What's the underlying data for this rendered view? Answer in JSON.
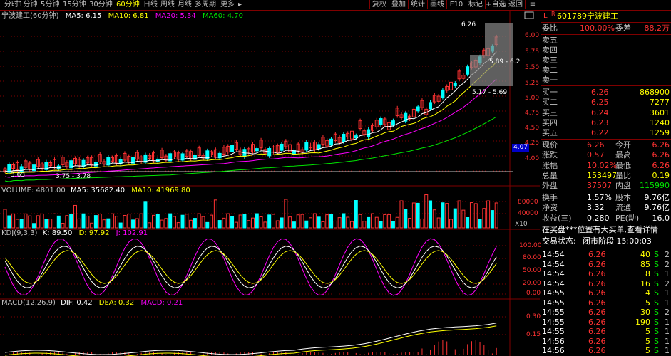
{
  "toolbar": {
    "timeframes": [
      "分时",
      "1分钟",
      "5分钟",
      "15分钟",
      "30分钟",
      "60分钟",
      "日线",
      "周线",
      "月线",
      "多周期",
      "更多"
    ],
    "active_timeframe": "60分钟",
    "buttons": [
      "复权",
      "叠加",
      "统计",
      "画线",
      "F10",
      "标记",
      "+自选",
      "返回"
    ]
  },
  "chart": {
    "title": "宁波建工(60分钟)",
    "ma": {
      "ma5": "MA5: 6.15",
      "ma10": "MA10: 6.81",
      "ma20": "MA20: 5.34",
      "ma60": "MA60: 4.70"
    },
    "price_axis": [
      "6.00",
      "5.75",
      "5.50",
      "5.25",
      "5.00",
      "4.75",
      "4.50",
      "4.25",
      "4.00"
    ],
    "current_price_tag": "4.07",
    "annotations": {
      "high": "6.26",
      "mid": "5.89 - 6.2",
      "low": "5.17 - 5.69",
      "min_low": "3.63",
      "pair_low": "3.75 - 3.78"
    },
    "volume": {
      "label": "VOLUME: 4801.00",
      "ma5": "MA5: 35682.40",
      "ma10": "MA10: 41969.80",
      "axis": [
        "80000",
        "40000"
      ],
      "unit": "X10"
    },
    "kdj": {
      "label": "KDJ(9,3,3)",
      "k": "K: 89.50",
      "d": "D: 97.92",
      "j": "J: 102.91",
      "axis": [
        "100.00",
        "80.00",
        "50.00",
        "20.00",
        "0.00"
      ]
    },
    "macd": {
      "label": "MACD(12,26,9)",
      "dif": "DIF: 0.42",
      "dea": "DEA: 0.32",
      "macd": "MACD: 0.21",
      "axis": [
        "0.30",
        "0.15"
      ]
    }
  },
  "stock": {
    "code": "601789",
    "name": "宁波建工"
  },
  "orderbook": {
    "weibi_label": "委比",
    "weibi": "100.00%",
    "weicha_label": "委差",
    "weicha": "88.2万",
    "sells": [
      {
        "label": "卖五",
        "price": "",
        "vol": ""
      },
      {
        "label": "卖四",
        "price": "",
        "vol": ""
      },
      {
        "label": "卖三",
        "price": "",
        "vol": ""
      },
      {
        "label": "卖二",
        "price": "",
        "vol": ""
      },
      {
        "label": "卖一",
        "price": "",
        "vol": ""
      }
    ],
    "buys": [
      {
        "label": "买一",
        "price": "6.26",
        "vol": "868900"
      },
      {
        "label": "买二",
        "price": "6.25",
        "vol": "7277"
      },
      {
        "label": "买三",
        "price": "6.24",
        "vol": "3601"
      },
      {
        "label": "买四",
        "price": "6.23",
        "vol": "1240"
      },
      {
        "label": "买五",
        "price": "6.22",
        "vol": "1259"
      }
    ]
  },
  "quote": [
    {
      "l1": "现价",
      "v1": "6.26",
      "l2": "今开",
      "v2": "6.26"
    },
    {
      "l1": "涨跌",
      "v1": "0.57",
      "l2": "最高",
      "v2": "6.26"
    },
    {
      "l1": "涨幅",
      "v1": "10.02%",
      "l2": "最低",
      "v2": "6.26"
    },
    {
      "l1": "总量",
      "v1": "153497",
      "l2": "量比",
      "v2": "0.19"
    },
    {
      "l1": "外盘",
      "v1": "37507",
      "l2": "内盘",
      "v2": "115990"
    }
  ],
  "fundamentals": [
    {
      "l1": "换手",
      "v1": "1.57%",
      "l2": "股本",
      "v2": "9.76亿"
    },
    {
      "l1": "净资",
      "v1": "3.32",
      "l2": "流通",
      "v2": "9.76亿"
    },
    {
      "l1": "收益(三)",
      "v1": "0.280",
      "l2": "PE(动)",
      "v2": "16.0"
    }
  ],
  "notice": "在买盘***位置有大买单,查看详情",
  "trade_status_label": "交易状态:",
  "trade_status": "闭市阶段 15:00:03",
  "ticks": [
    {
      "t": "14:54",
      "p": "6.26",
      "v": "40",
      "d": "S",
      "n": "2"
    },
    {
      "t": "14:54",
      "p": "6.26",
      "v": "85",
      "d": "S",
      "n": "2"
    },
    {
      "t": "14:54",
      "p": "6.26",
      "v": "8",
      "d": "S",
      "n": "1"
    },
    {
      "t": "14:54",
      "p": "6.26",
      "v": "16",
      "d": "S",
      "n": "2"
    },
    {
      "t": "14:55",
      "p": "6.26",
      "v": "4",
      "d": "S",
      "n": "1"
    },
    {
      "t": "14:55",
      "p": "6.26",
      "v": "5",
      "d": "S",
      "n": "1"
    },
    {
      "t": "14:55",
      "p": "6.26",
      "v": "30",
      "d": "S",
      "n": "2"
    },
    {
      "t": "14:55",
      "p": "6.26",
      "v": "190",
      "d": "S",
      "n": "1"
    },
    {
      "t": "14:55",
      "p": "6.26",
      "v": "5",
      "d": "S",
      "n": "1"
    },
    {
      "t": "14:56",
      "p": "6.26",
      "v": "5",
      "d": "S",
      "n": "1"
    },
    {
      "t": "14:56",
      "p": "6.26",
      "v": "5",
      "d": "S",
      "n": "1"
    }
  ],
  "colors": {
    "up": "#ff3232",
    "down": "#00ffff",
    "ma5": "#ffffff",
    "ma10": "#ffff00",
    "ma20": "#ff00ff",
    "ma60": "#00e600",
    "grid": "#800000"
  }
}
